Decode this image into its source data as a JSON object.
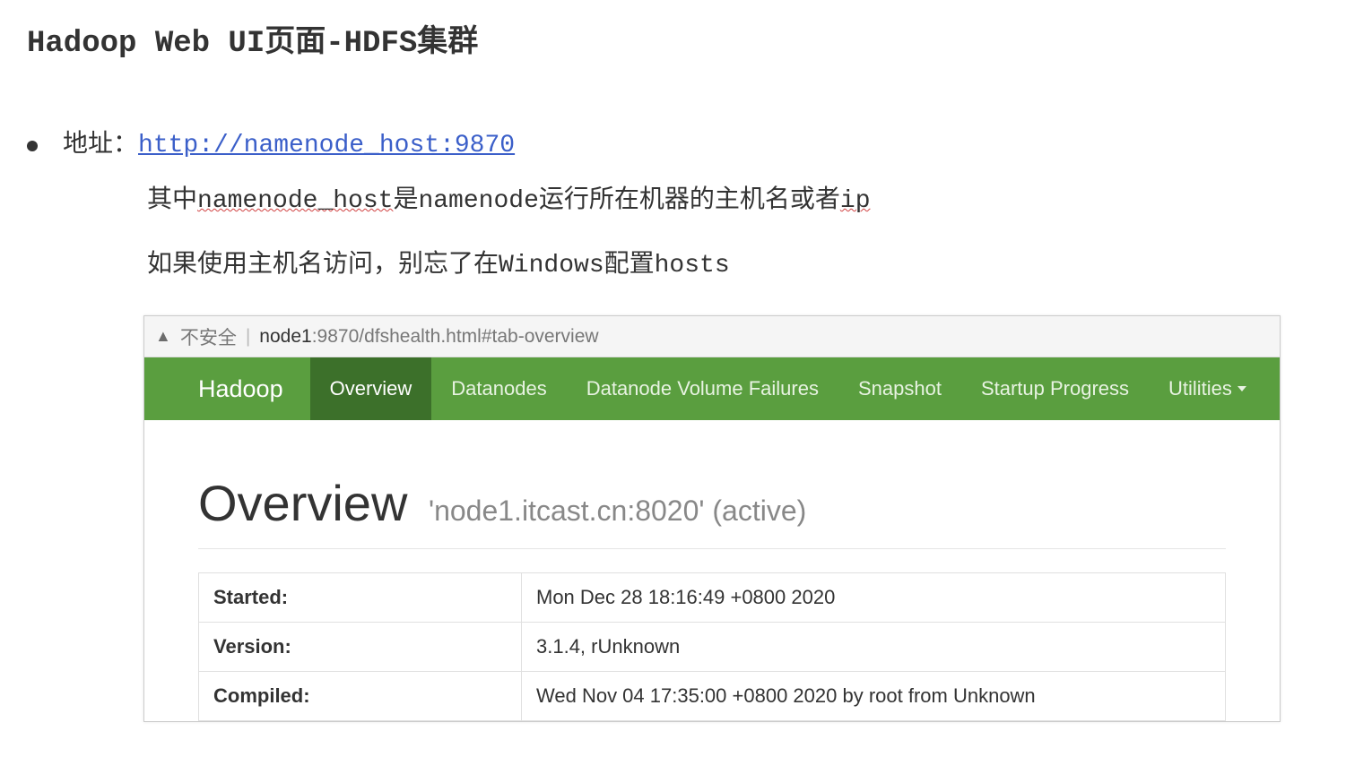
{
  "page_title": "Hadoop Web UI页面-HDFS集群",
  "bullet": {
    "label": "地址：",
    "url": "http://namenode_host:9870"
  },
  "desc1": {
    "prefix": "其中",
    "w1": "namenode_host",
    "mid": "是namenode运行所在机器的主机名或者",
    "w2": "ip"
  },
  "desc2": "如果使用主机名访问，别忘了在Windows配置hosts",
  "address_bar": {
    "insecure": "不安全",
    "host": "node1",
    "path": ":9870/dfshealth.html#tab-overview"
  },
  "navbar": {
    "brand": "Hadoop",
    "items": [
      {
        "label": "Overview",
        "active": true,
        "dropdown": false
      },
      {
        "label": "Datanodes",
        "active": false,
        "dropdown": false
      },
      {
        "label": "Datanode Volume Failures",
        "active": false,
        "dropdown": false
      },
      {
        "label": "Snapshot",
        "active": false,
        "dropdown": false
      },
      {
        "label": "Startup Progress",
        "active": false,
        "dropdown": false
      },
      {
        "label": "Utilities",
        "active": false,
        "dropdown": true
      }
    ]
  },
  "overview": {
    "title": "Overview",
    "subtitle": "'node1.itcast.cn:8020' (active)"
  },
  "info_rows": [
    {
      "label": "Started:",
      "value": "Mon Dec 28 18:16:49 +0800 2020"
    },
    {
      "label": "Version:",
      "value": "3.1.4, rUnknown"
    },
    {
      "label": "Compiled:",
      "value": "Wed Nov 04 17:35:00 +0800 2020 by root from Unknown"
    }
  ]
}
